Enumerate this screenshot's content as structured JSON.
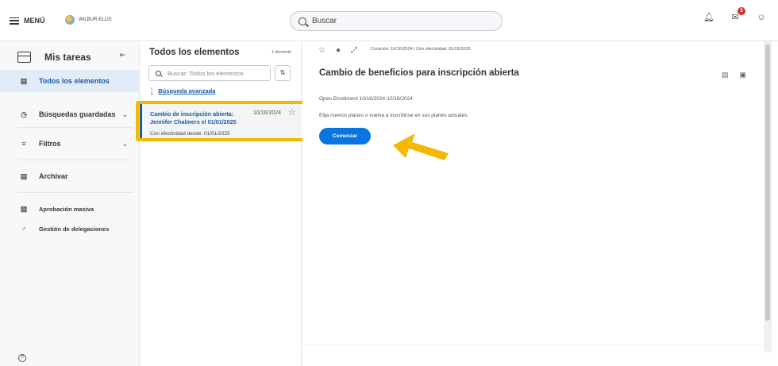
{
  "topbar": {
    "menu_label": "MENÚ",
    "brand": "WILBUR-ELLIS",
    "search_label": "Buscar",
    "inbox_badge": "5"
  },
  "sidebar": {
    "title": "Mis tareas",
    "items": [
      {
        "label": "Todos los elementos",
        "icon": "doc-icon"
      },
      {
        "label": "Búsquedas guardadas",
        "icon": "history-icon"
      },
      {
        "label": "Filtros",
        "icon": "filter-icon"
      },
      {
        "label": "Archivar",
        "icon": "archive-icon"
      },
      {
        "label": "Aprobación masiva",
        "icon": "approve-icon"
      },
      {
        "label": "Gestión de delegaciones",
        "icon": "delegate-icon"
      }
    ]
  },
  "list": {
    "title": "Todos los elementos",
    "count": "1 elemento",
    "search_placeholder": "Buscar: Todos los elementos",
    "advanced_search": "Búsqueda avanzada",
    "card": {
      "title": "Cambio de inscripción abierta: Jennifer Chalmers el 01/01/2025",
      "date": "10/16/2024",
      "effective": "Con efectividad desde: 01/01/2025"
    }
  },
  "detail": {
    "meta": "Creación: 10/16/2024 | Con efectividad: 01/01/2025",
    "title": "Cambio de beneficios para inscripción abierta",
    "line1": "Open Enrollment 10/16/2024-10/18/2024",
    "line2": "Elija nuevos planes o vuelva a inscribirse en sus planes actuales.",
    "button": "Comenzar"
  },
  "colors": {
    "accent": "#0875e1",
    "highlight": "#f5b800",
    "arrow": "#f5b800",
    "badge": "#d92c2c"
  }
}
